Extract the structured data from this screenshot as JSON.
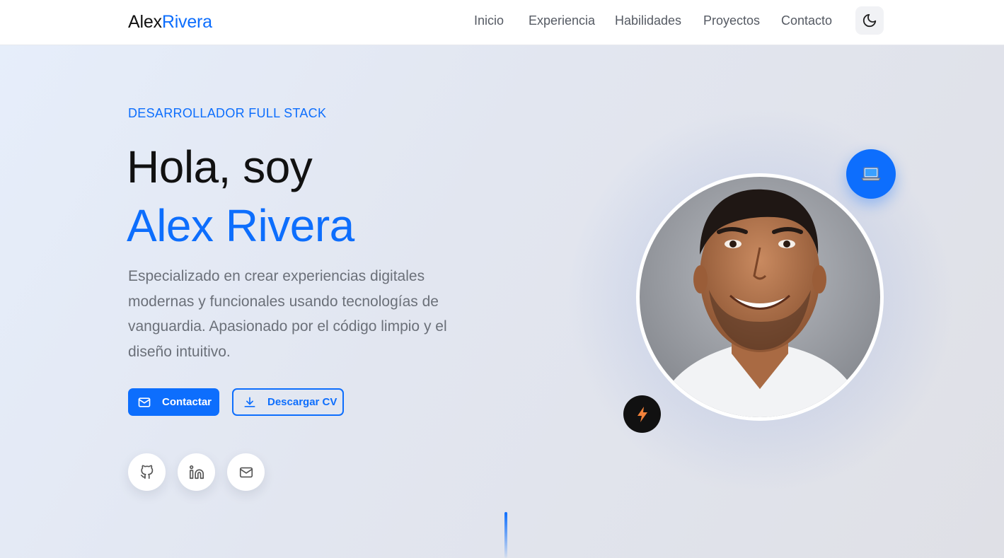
{
  "nav": {
    "logo_first": "Alex",
    "logo_last": "Rivera",
    "links": [
      "Inicio",
      "Experiencia",
      "Habilidades",
      "Proyectos",
      "Contacto"
    ],
    "theme_icon": "moon-icon"
  },
  "hero": {
    "subtitle": "DESARROLLADOR FULL STACK",
    "greeting": "Hola, soy",
    "name": "Alex Rivera",
    "description": "Especializado en crear experiencias digitales modernas y funcionales usando tecnologías de vanguardia. Apasionado por el código limpio y el diseño intuitivo.",
    "buttons": {
      "contact": "Contactar",
      "download_cv": "Descargar CV"
    },
    "social_icons": [
      "github-icon",
      "linkedin-icon",
      "mail-icon"
    ],
    "badges": [
      "laptop-icon",
      "lightning-icon"
    ]
  },
  "colors": {
    "accent": "#0d6efd",
    "text": "#111111",
    "muted": "#6b7079"
  }
}
